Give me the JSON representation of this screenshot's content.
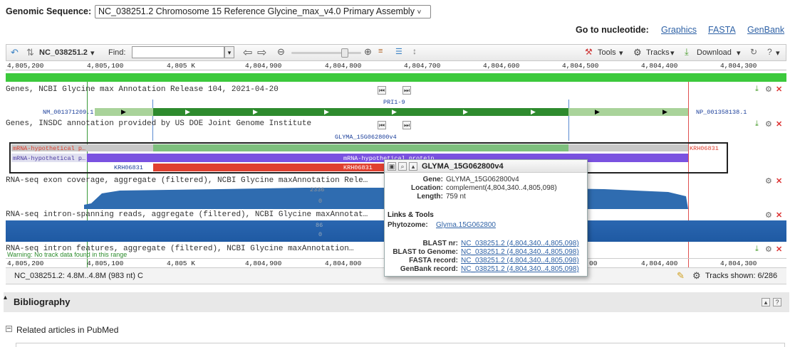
{
  "header": {
    "genomic_label": "Genomic Sequence:",
    "sequence_option": "NC_038251.2 Chromosome 15 Reference Glycine_max_v4.0 Primary Assembly",
    "goto_label": "Go to nucleotide:",
    "links": [
      "Graphics",
      "FASTA",
      "GenBank"
    ]
  },
  "toolbar": {
    "seq_name": "NC_038251.2",
    "find_label": "Find:",
    "find_value": "",
    "tools": "Tools",
    "tracks": "Tracks",
    "download": "Download"
  },
  "ruler": {
    "ticks": [
      "4,805,200",
      "4,805,100",
      "4,805 K",
      "4,804,900",
      "4,804,800",
      "4,804,700",
      "4,804,600",
      "4,804,500",
      "4,804,400",
      "4,804,300"
    ]
  },
  "tracks": {
    "genes_ncbi": "Genes, NCBI Glycine max Annotation Release 104, 2021-04-20",
    "pri": "PRI1-9",
    "nm": "NM_001371209.1",
    "np": "NP_001358138.1",
    "genes_insdc": "Genes, INSDC annotation provided by US DOE Joint Genome Institute",
    "glyma": "GLYMA_15G062800v4",
    "mrna1": "mRNA-hypothetical p…",
    "mrna2": "mRNA-hypothetical p…",
    "mrna_center": "mRNA-hypothetical protein",
    "krh_left": "KRH06831",
    "krh_mid": "KRH06831",
    "krh_right": "KRH06831",
    "rnaseq_exon": "RNA-seq exon coverage, aggregate (filtered), NCBI Glycine maxAnnotation Rele…",
    "rnaseq_exon_val": "2336",
    "rnaseq_exon_zero": "0",
    "rnaseq_intron": "RNA-seq intron-spanning reads, aggregate (filtered), NCBI Glycine maxAnnotat…",
    "rnaseq_intron_val": "86",
    "rnaseq_intron_zero": "0",
    "rnaseq_feat": "RNA-seq intron features, aggregate (filtered), NCBI Glycine maxAnnotation…",
    "warning": "Warning: No track data found in this range",
    "bottom_ticks": [
      "4,805,200",
      "4,805,100",
      "4,805 K",
      "4,804,900",
      "4,804,800",
      "00",
      "4,804,400",
      "4,804,300"
    ]
  },
  "popup": {
    "title": "GLYMA_15G062800v4",
    "gene_k": "Gene:",
    "gene_v": "GLYMA_15G062800v4",
    "loc_k": "Location:",
    "loc_v": "complement(4,804,340..4,805,098)",
    "len_k": "Length:",
    "len_v": "759 nt",
    "links_title": "Links & Tools",
    "phyto_k": "Phytozome:",
    "phyto_v": "Glyma.15G062800",
    "blastnr_k": "BLAST nr:",
    "blastnr_v": "NC_038251.2 (4,804,340..4,805,098)",
    "blastg_k": "BLAST to Genome:",
    "blastg_v": "NC_038251.2 (4,804,340..4,805,098)",
    "fasta_k": "FASTA record:",
    "fasta_v": "NC_038251.2 (4,804,340..4,805,098)",
    "gb_k": "GenBank record:",
    "gb_v": "NC_038251.2 (4,804,340..4,805,098)"
  },
  "status": {
    "range": "NC_038251.2: 4.8M..4.8M (983 nt) C",
    "tracks_shown": "Tracks shown: 6/286"
  },
  "bibliography": {
    "title": "Bibliography",
    "related": "Related articles in PubMed"
  },
  "colors": {
    "gene_green": "#2e8b2e",
    "light_green": "#a9d39a",
    "red": "#e04030",
    "purple": "#7a52e0",
    "coverage_blue": "#2f6cb0",
    "link": "#2f62a6"
  }
}
